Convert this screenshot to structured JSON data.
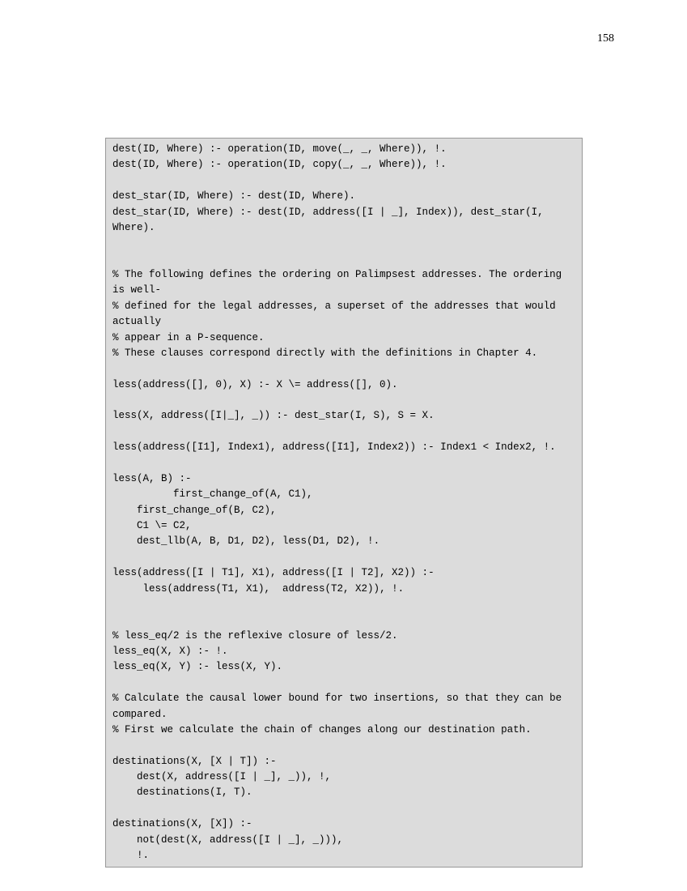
{
  "page_number": "158",
  "code": "dest(ID, Where) :- operation(ID, move(_, _, Where)), !.\ndest(ID, Where) :- operation(ID, copy(_, _, Where)), !.\n\ndest_star(ID, Where) :- dest(ID, Where).\ndest_star(ID, Where) :- dest(ID, address([I | _], Index)), dest_star(I, Where).\n\n\n% The following defines the ordering on Palimpsest addresses. The ordering is well-\n% defined for the legal addresses, a superset of the addresses that would actually\n% appear in a P-sequence.\n% These clauses correspond directly with the definitions in Chapter 4.\n\nless(address([], 0), X) :- X \\= address([], 0).\n\nless(X, address([I|_], _)) :- dest_star(I, S), S = X.\n\nless(address([I1], Index1), address([I1], Index2)) :- Index1 < Index2, !.\n\nless(A, B) :-\n          first_change_of(A, C1),\n    first_change_of(B, C2),\n    C1 \\= C2,\n    dest_llb(A, B, D1, D2), less(D1, D2), !.\n\nless(address([I | T1], X1), address([I | T2], X2)) :-\n     less(address(T1, X1),  address(T2, X2)), !.\n\n\n% less_eq/2 is the reflexive closure of less/2.\nless_eq(X, X) :- !.\nless_eq(X, Y) :- less(X, Y).\n\n% Calculate the causal lower bound for two insertions, so that they can be compared.\n% First we calculate the chain of changes along our destination path.\n\ndestinations(X, [X | T]) :-\n    dest(X, address([I | _], _)), !,\n    destinations(I, T).\n\ndestinations(X, [X]) :-\n    not(dest(X, address([I | _], _))),\n    !."
}
